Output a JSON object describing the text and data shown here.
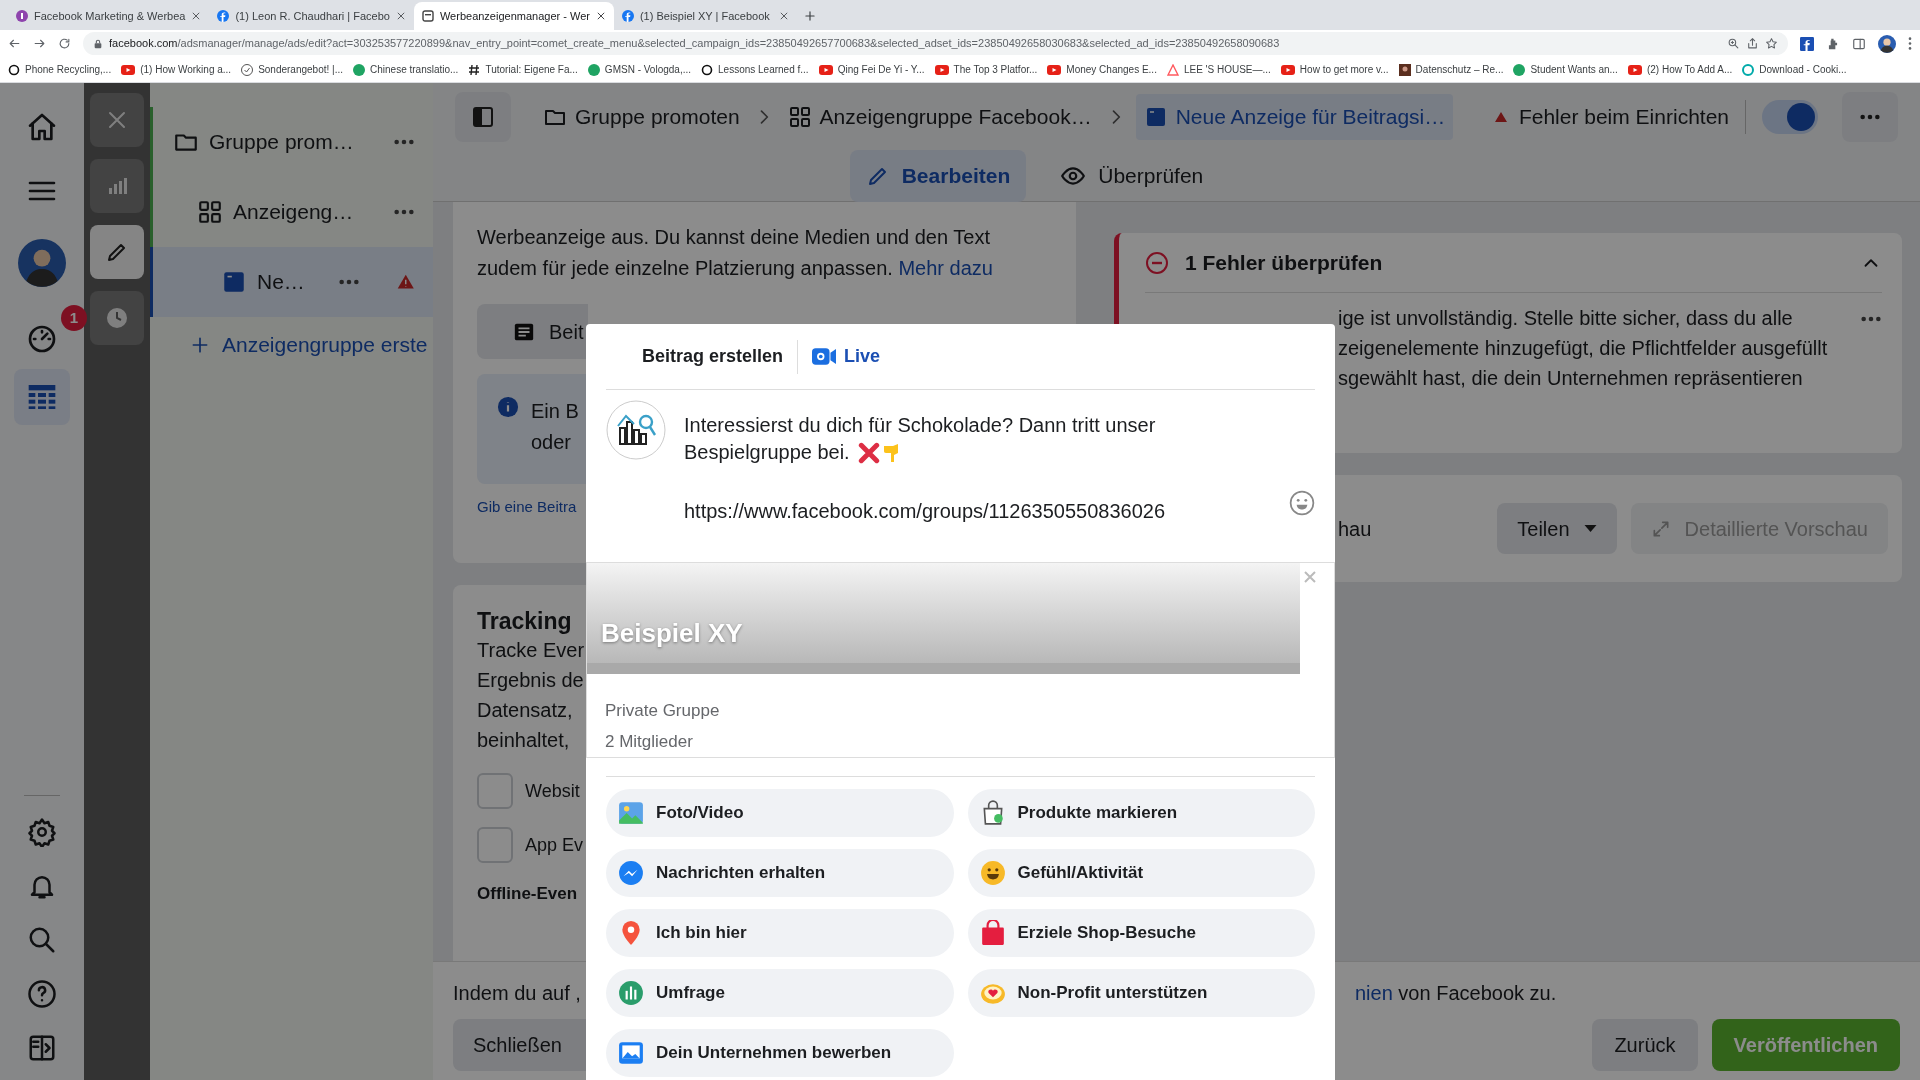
{
  "browser": {
    "tabs": [
      {
        "title": "Facebook Marketing & Werbea",
        "kind": "course",
        "selected": false
      },
      {
        "title": "(1) Leon R. Chaudhari | Facebo",
        "kind": "facebook",
        "selected": false
      },
      {
        "title": "Werbeanzeigenmanager - Wer",
        "kind": "ads",
        "selected": true
      },
      {
        "title": "(1) Beispiel XY | Facebook",
        "kind": "facebook",
        "selected": false
      }
    ],
    "url_host": "facebook.com",
    "url_path": "/adsmanager/manage/ads/edit?act=303253577220899&nav_entry_point=comet_create_menu&selected_campaign_ids=23850492657700683&selected_adset_ids=23850492658030683&selected_ad_ids=23850492658090683",
    "bookmarks": [
      {
        "title": "Phone Recycling,...",
        "kind": "ring"
      },
      {
        "title": "(1) How Working a...",
        "kind": "video"
      },
      {
        "title": "Sonderangebot! |...",
        "kind": "check"
      },
      {
        "title": "Chinese translatio...",
        "kind": "green"
      },
      {
        "title": "Tutorial: Eigene Fa...",
        "kind": "hash"
      },
      {
        "title": "GMSN - Vologda,...",
        "kind": "green"
      },
      {
        "title": "Lessons Learned f...",
        "kind": "ring"
      },
      {
        "title": "Qing Fei De Yi - Y...",
        "kind": "video"
      },
      {
        "title": "The Top 3 Platfor...",
        "kind": "video"
      },
      {
        "title": "Money Changes E...",
        "kind": "video"
      },
      {
        "title": "LEE 'S HOUSE—...",
        "kind": "home"
      },
      {
        "title": "How to get more v...",
        "kind": "video"
      },
      {
        "title": "Datenschutz – Re...",
        "kind": "image"
      },
      {
        "title": "Student Wants an...",
        "kind": "green"
      },
      {
        "title": "(2) How To Add A...",
        "kind": "video"
      },
      {
        "title": "Download - Cooki...",
        "kind": "teal"
      }
    ]
  },
  "nav_rail": {
    "items": [
      {
        "kind": "home",
        "selected": false
      },
      {
        "kind": "menu",
        "selected": false
      },
      {
        "kind": "avatar",
        "selected": false
      },
      {
        "kind": "gauge",
        "selected": false,
        "badge": "1"
      },
      {
        "kind": "table",
        "selected": true
      }
    ],
    "bottom_items": [
      {
        "kind": "settings"
      },
      {
        "kind": "bell"
      },
      {
        "kind": "search"
      },
      {
        "kind": "help"
      },
      {
        "kind": "panel"
      }
    ]
  },
  "tool_strip": [
    {
      "kind": "close",
      "selected": false
    },
    {
      "kind": "chart",
      "selected": false
    },
    {
      "kind": "edit",
      "selected": true
    },
    {
      "kind": "history",
      "selected": false
    }
  ],
  "tree": {
    "items": [
      {
        "label": "Gruppe prom…",
        "kind": "campaign",
        "selected": false,
        "error": false,
        "children": [
          {
            "label": "Anzeigeng…",
            "kind": "adset",
            "selected": false,
            "error": false,
            "children": [
              {
                "label": "Ne…",
                "kind": "ad",
                "selected": true,
                "error": true
              }
            ]
          }
        ]
      }
    ],
    "add_label": "Anzeigengruppe erste"
  },
  "header": {
    "breadcrumbs": [
      {
        "label": "Gruppe promoten",
        "kind": "campaign",
        "selected": false
      },
      {
        "label": "Anzeigengruppe Facebook…",
        "kind": "adset",
        "selected": false
      },
      {
        "label": "Neue Anzeige für Beitragsi…",
        "kind": "ad",
        "selected": true
      }
    ],
    "status": "Fehler beim Einrichten",
    "toggle_on": true,
    "modes": [
      {
        "label": "Bearbeiten",
        "kind": "edit",
        "selected": true
      },
      {
        "label": "Überprüfen",
        "kind": "review",
        "selected": false
      }
    ]
  },
  "left_panel": {
    "intro_lines": [
      "Werbeanzeige aus. Du kannst deine Medien und den Text",
      "zudem für jede einzelne Platzierung anpassen."
    ],
    "intro_link": "Mehr dazu",
    "post_button": "Beit",
    "info_lines": [
      "Ein B",
      "oder"
    ],
    "hint_link": "Gib eine Beitra",
    "tracking": {
      "title": "Tracking",
      "lines": [
        "Tracke Ever",
        "Ergebnis de",
        "Datensatz,",
        "beinhaltet,"
      ],
      "options": [
        {
          "label": "Websit",
          "checked": false
        },
        {
          "label": "App Ev",
          "checked": false
        }
      ],
      "subheading": "Offline-Even"
    }
  },
  "right_panel": {
    "error_title": "1 Fehler überprüfen",
    "expanded": true,
    "error_lines": [
      "ige ist unvollständig. Stelle bitte sicher, dass du alle",
      "zeigenelemente hinzugefügt, die Pflichtfelder ausgefüllt",
      "sgewählt hast, die dein Unternehmen repräsentieren"
    ],
    "preview_label": "hau",
    "share": "Teilen",
    "detail": "Detaillierte Vorschau"
  },
  "footer": {
    "consent_start": "Indem du auf ,",
    "consent_link": "nien",
    "consent_end": "von Facebook zu.",
    "close": "Schließen",
    "back": "Zurück",
    "publish": "Veröffentlichen"
  },
  "composer": {
    "tabs": [
      {
        "label": "Beitrag erstellen",
        "kind": "post",
        "selected": true
      },
      {
        "label": "Live",
        "kind": "live",
        "selected": false
      }
    ],
    "text_lines": [
      "Interessierst du dich für Schokolade? Dann tritt unser",
      "Bespielgruppe bei."
    ],
    "url": "https://www.facebook.com/groups/1126350550836026",
    "preview": {
      "title": "Beispiel XY",
      "privacy": "Private Gruppe",
      "members": "2 Mitglieder"
    },
    "actions": [
      {
        "label": "Foto/Video",
        "kind": "photo"
      },
      {
        "label": "Produkte markieren",
        "kind": "products"
      },
      {
        "label": "Nachrichten erhalten",
        "kind": "messenger"
      },
      {
        "label": "Gefühl/Aktivität",
        "kind": "feeling"
      },
      {
        "label": "Ich bin hier",
        "kind": "location"
      },
      {
        "label": "Erziele Shop-Besuche",
        "kind": "shop"
      },
      {
        "label": "Umfrage",
        "kind": "poll"
      },
      {
        "label": "Non-Profit unterstützen",
        "kind": "charity"
      },
      {
        "label": "Dein Unternehmen bewerben",
        "kind": "promote"
      }
    ]
  }
}
